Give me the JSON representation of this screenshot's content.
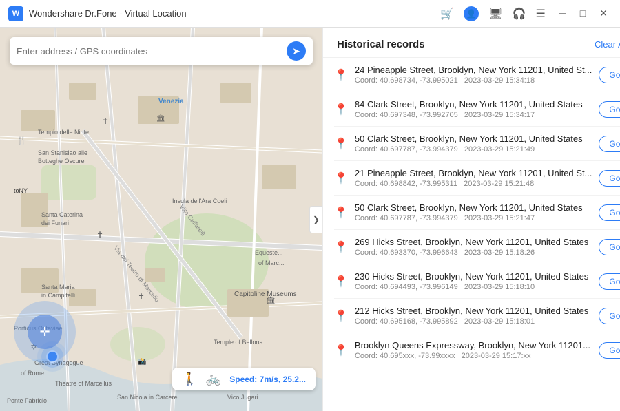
{
  "titleBar": {
    "logoText": "W",
    "title": "Wondershare Dr.Fone - Virtual Location",
    "icons": [
      "cart",
      "user",
      "monitor",
      "headphones",
      "list"
    ],
    "controls": [
      "minimize",
      "maximize",
      "close"
    ]
  },
  "searchBar": {
    "placeholder": "Enter address / GPS coordinates"
  },
  "speedBar": {
    "label": "Speed:",
    "value": "7m/s, 25.2..."
  },
  "panel": {
    "title": "Historical records",
    "clearAllLabel": "Clear All"
  },
  "records": [
    {
      "address": "24 Pineapple Street, Brooklyn, New York 11201, United St...",
      "coord": "Coord: 40.698734, -73.995021",
      "date": "2023-03-29 15:34:18"
    },
    {
      "address": "84 Clark Street, Brooklyn, New York 11201, United States",
      "coord": "Coord: 40.697348, -73.992705",
      "date": "2023-03-29 15:34:17"
    },
    {
      "address": "50 Clark Street, Brooklyn, New York 11201, United States",
      "coord": "Coord: 40.697787, -73.994379",
      "date": "2023-03-29 15:21:49"
    },
    {
      "address": "21 Pineapple Street, Brooklyn, New York 11201, United St...",
      "coord": "Coord: 40.698842, -73.995311",
      "date": "2023-03-29 15:21:48"
    },
    {
      "address": "50 Clark Street, Brooklyn, New York 11201, United States",
      "coord": "Coord: 40.697787, -73.994379",
      "date": "2023-03-29 15:21:47"
    },
    {
      "address": "269 Hicks Street, Brooklyn, New York 11201, United States",
      "coord": "Coord: 40.693370, -73.996643",
      "date": "2023-03-29 15:18:26"
    },
    {
      "address": "230 Hicks Street, Brooklyn, New York 11201, United States",
      "coord": "Coord: 40.694493, -73.996149",
      "date": "2023-03-29 15:18:10"
    },
    {
      "address": "212 Hicks Street, Brooklyn, New York 11201, United States",
      "coord": "Coord: 40.695168, -73.995892",
      "date": "2023-03-29 15:18:01"
    },
    {
      "address": "Brooklyn Queens Expressway, Brooklyn, New York 11201...",
      "coord": "Coord: 40.695xxx, -73.99xxxx",
      "date": "2023-03-29 15:17:xx"
    }
  ],
  "goButtonLabel": "Go",
  "colors": {
    "accent": "#2d7cf6"
  }
}
